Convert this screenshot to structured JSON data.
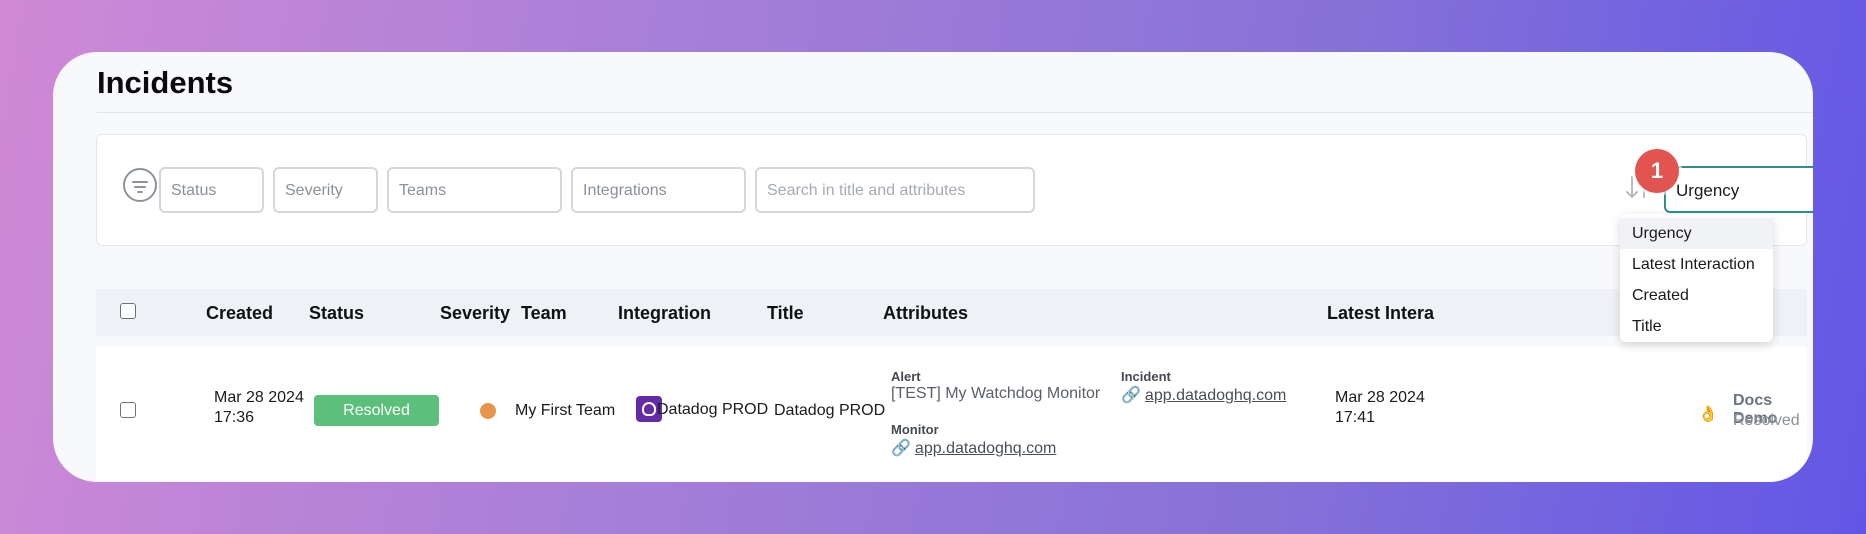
{
  "page": {
    "title": "Incidents"
  },
  "filters": {
    "status_placeholder": "Status",
    "severity_placeholder": "Severity",
    "teams_placeholder": "Teams",
    "integrations_placeholder": "Integrations",
    "search_placeholder": "Search in title and attributes"
  },
  "sort": {
    "selected": "Urgency",
    "options": [
      "Urgency",
      "Latest Interaction",
      "Created",
      "Title"
    ]
  },
  "step_badge": "1",
  "table": {
    "headers": {
      "created": "Created",
      "status": "Status",
      "severity": "Severity",
      "team": "Team",
      "integration": "Integration",
      "title": "Title",
      "attributes": "Attributes",
      "latest": "Latest Intera"
    },
    "rows": [
      {
        "created_date": "Mar 28 2024",
        "created_time": "17:36",
        "status": "Resolved",
        "severity_color": "#e8944a",
        "team": "My First Team",
        "integration": "Datadog PROD",
        "title": "Datadog PROD",
        "attributes": {
          "alert_label": "Alert",
          "alert_value": "[TEST] My Watchdog Monitor",
          "incident_label": "Incident",
          "incident_link": "app.datadoghq.com",
          "monitor_label": "Monitor",
          "monitor_link": "app.datadoghq.com"
        },
        "latest_date": "Mar 28 2024",
        "latest_time": "17:41",
        "latest_user": "Docs Demo",
        "latest_status": "Resolved"
      }
    ]
  },
  "colors": {
    "status_resolved": "#5cc07a",
    "sort_focus_border": "#2f8f8a",
    "step_badge": "#e2544f"
  }
}
